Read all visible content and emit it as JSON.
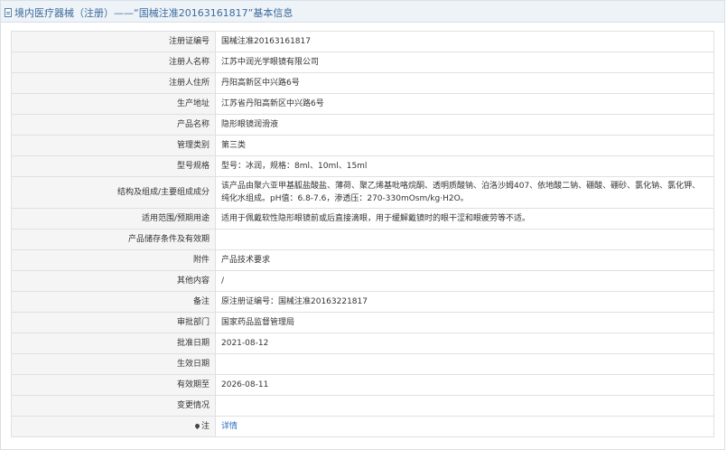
{
  "header": {
    "title": "境内医疗器械（注册）——“国械注准20163161817”基本信息"
  },
  "rows": [
    {
      "label": "注册证编号",
      "value": "国械注准20163161817"
    },
    {
      "label": "注册人名称",
      "value": "江苏中润光学眼镜有限公司"
    },
    {
      "label": "注册人住所",
      "value": "丹阳高新区中兴路6号"
    },
    {
      "label": "生产地址",
      "value": "江苏省丹阳高新区中兴路6号"
    },
    {
      "label": "产品名称",
      "value": "隐形眼镜润滑液"
    },
    {
      "label": "管理类别",
      "value": "第三类"
    },
    {
      "label": "型号规格",
      "value": "型号：冰润，规格：8ml、10ml、15ml"
    },
    {
      "label": "结构及组成/主要组成成分",
      "value": "该产品由聚六亚甲基胍盐酸盐、薄荷、聚乙烯基吡咯烷酮、透明质酸钠、泊洛沙姆407、依地酸二钠、硼酸、硼砂、氯化钠、氯化钾、纯化水组成。pH值：6.8-7.6，渗透压：270-330mOsm/kg·H2O。"
    },
    {
      "label": "适用范围/预期用途",
      "value": "适用于佩戴软性隐形眼镜前或后直接滴眼，用于缓解戴镜时的眼干涩和眼疲劳等不适。"
    },
    {
      "label": "产品储存条件及有效期",
      "value": ""
    },
    {
      "label": "附件",
      "value": "产品技术要求"
    },
    {
      "label": "其他内容",
      "value": "/"
    },
    {
      "label": "备注",
      "value": "原注册证编号：国械注准20163221817"
    },
    {
      "label": "审批部门",
      "value": "国家药品监督管理局"
    },
    {
      "label": "批准日期",
      "value": "2021-08-12"
    },
    {
      "label": "生效日期",
      "value": ""
    },
    {
      "label": "有效期至",
      "value": "2026-08-11"
    },
    {
      "label": "变更情况",
      "value": ""
    }
  ],
  "note": {
    "label": "注",
    "link_text": "详情"
  }
}
